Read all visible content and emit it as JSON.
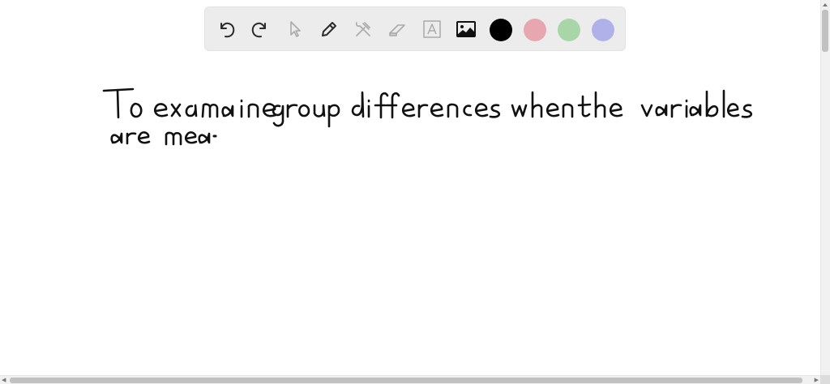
{
  "toolbar": {
    "tools": [
      {
        "name": "undo",
        "icon": "undo-icon",
        "enabled": true
      },
      {
        "name": "redo",
        "icon": "redo-icon",
        "enabled": true
      },
      {
        "name": "select",
        "icon": "pointer-icon",
        "enabled": false
      },
      {
        "name": "pen",
        "icon": "pencil-icon",
        "enabled": true
      },
      {
        "name": "tools",
        "icon": "hammer-wrench-icon",
        "enabled": false
      },
      {
        "name": "eraser",
        "icon": "eraser-icon",
        "enabled": false
      },
      {
        "name": "text",
        "icon": "text-box-icon",
        "enabled": false
      },
      {
        "name": "image",
        "icon": "image-icon",
        "enabled": true
      }
    ],
    "colors": [
      {
        "name": "black",
        "hex": "#000000",
        "selected": true
      },
      {
        "name": "red",
        "hex": "#e8a6b0",
        "selected": false
      },
      {
        "name": "green",
        "hex": "#a9d6a9",
        "selected": false
      },
      {
        "name": "blue",
        "hex": "#b1b1ea",
        "selected": false
      }
    ]
  },
  "canvas": {
    "handwriting_lines": [
      "To examine group differences when the variables",
      "are mea-"
    ]
  }
}
